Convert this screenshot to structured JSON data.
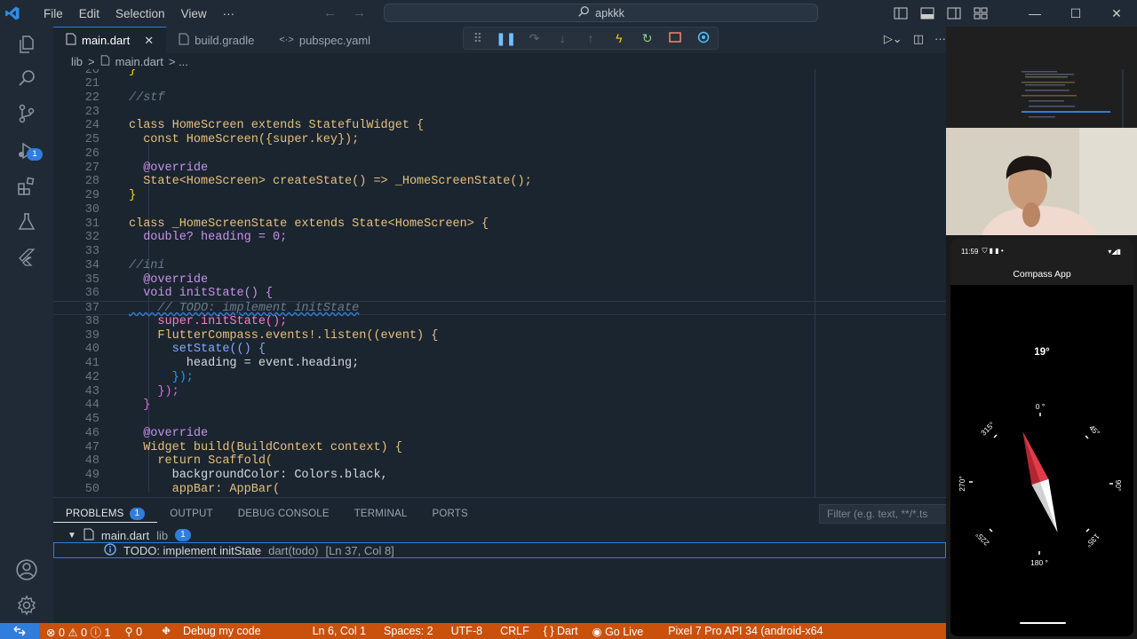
{
  "titlebar": {
    "menu": [
      "File",
      "Edit",
      "Selection",
      "View",
      "···"
    ],
    "search_text": "apkkk"
  },
  "tabs": [
    {
      "label": "main.dart",
      "active": true,
      "close": "✕"
    },
    {
      "label": "build.gradle",
      "active": false
    },
    {
      "label": "pubspec.yaml",
      "active": false
    }
  ],
  "breadcrumb": {
    "folder": "lib",
    "sep": ">",
    "file": "main.dart",
    "more": "> ..."
  },
  "activity_badge": "1",
  "editor": {
    "lines": [
      {
        "n": "20",
        "c": "}"
      },
      {
        "n": "21",
        "c": ""
      },
      {
        "n": "22",
        "c": "//stf"
      },
      {
        "n": "23",
        "c": ""
      },
      {
        "n": "24",
        "c": "class HomeScreen extends StatefulWidget {"
      },
      {
        "n": "25",
        "c": "  const HomeScreen({super.key});"
      },
      {
        "n": "26",
        "c": ""
      },
      {
        "n": "27",
        "c": "  @override"
      },
      {
        "n": "28",
        "c": "  State<HomeScreen> createState() => _HomeScreenState();"
      },
      {
        "n": "29",
        "c": "}"
      },
      {
        "n": "30",
        "c": ""
      },
      {
        "n": "31",
        "c": "class _HomeScreenState extends State<HomeScreen> {"
      },
      {
        "n": "32",
        "c": "  double? heading = 0;"
      },
      {
        "n": "33",
        "c": ""
      },
      {
        "n": "34",
        "c": "//ini"
      },
      {
        "n": "35",
        "c": "  @override"
      },
      {
        "n": "36",
        "c": "  void initState() {"
      },
      {
        "n": "37",
        "c": "    // TODO: implement initState"
      },
      {
        "n": "38",
        "c": "    super.initState();"
      },
      {
        "n": "39",
        "c": "    FlutterCompass.events!.listen((event) {"
      },
      {
        "n": "40",
        "c": "      setState(() {"
      },
      {
        "n": "41",
        "c": "        heading = event.heading;"
      },
      {
        "n": "42",
        "c": "      });"
      },
      {
        "n": "43",
        "c": "    });"
      },
      {
        "n": "44",
        "c": "  }"
      },
      {
        "n": "45",
        "c": ""
      },
      {
        "n": "46",
        "c": "  @override"
      },
      {
        "n": "47",
        "c": "  Widget build(BuildContext context) {"
      },
      {
        "n": "48",
        "c": "    return Scaffold("
      },
      {
        "n": "49",
        "c": "      backgroundColor: Colors.black,"
      },
      {
        "n": "50",
        "c": "      appBar: AppBar("
      }
    ]
  },
  "panel": {
    "tabs": [
      "PROBLEMS",
      "OUTPUT",
      "DEBUG CONSOLE",
      "TERMINAL",
      "PORTS"
    ],
    "problems_count": "1",
    "filter_placeholder": "Filter (e.g. text, **/*.ts",
    "file_row": {
      "file": "main.dart",
      "folder": "lib",
      "count": "1"
    },
    "problem": {
      "message": "TODO: implement initState",
      "source": "dart(todo)",
      "location": "[Ln 37, Col 8]"
    }
  },
  "statusbar": {
    "errors": "0",
    "warnings": "0",
    "infos": "1",
    "ports": "0",
    "debug": "Debug my code",
    "position": "Ln 6, Col 1",
    "spaces": "Spaces: 2",
    "encoding": "UTF-8",
    "eol": "CRLF",
    "language": "Dart",
    "golive": "Go Live",
    "device": "Pixel 7 Pro API 34 (android-x64"
  },
  "phone": {
    "time": "11:59",
    "app_title": "Compass App",
    "heading_value": "19°",
    "dial_labels": {
      "n": "0 °",
      "ne": "45°",
      "e": "90°",
      "se": "135°",
      "s": "180 °",
      "sw": "225°",
      "w": "270°",
      "nw": "315°"
    }
  },
  "colors": {
    "statusbar": "#c9510c",
    "accent": "#2f7ddd",
    "needle_red": "#e23b4a"
  }
}
